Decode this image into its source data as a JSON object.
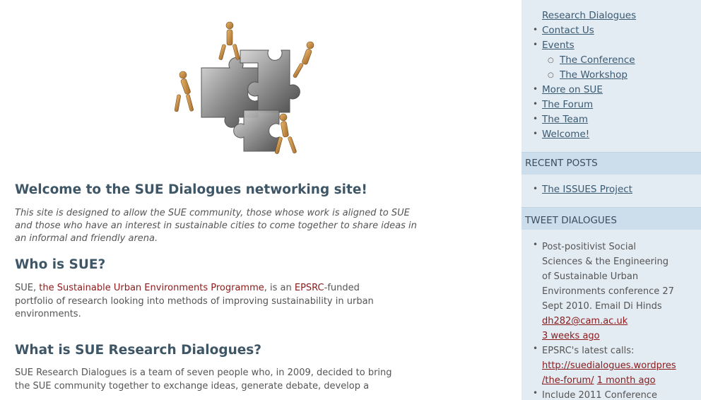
{
  "main": {
    "heading": "Welcome to the SUE Dialogues networking site!",
    "intro_line1": "This site is designed to allow the SUE community, those whose work is aligned to SUE",
    "intro_line2": "and those who have an interest in sustainable cities to come together to share ideas in",
    "intro_line3": "an informal and friendly arena.",
    "who_heading": "Who is SUE?",
    "who_prefix": "SUE, ",
    "who_link": "the Sustainable Urban Environments Programme",
    "who_mid": ",  is an ",
    "epsrc_link": "EPSRC",
    "who_rest1": "-funded",
    "who_line2": "portfolio of research looking into methods of improving sustainability in urban",
    "who_line3": "environments.",
    "what_heading": "What is SUE Research Dialogues?",
    "what_line1": "SUE Research Dialogues is a team of seven people who, in 2009, decided to bring",
    "what_line2": "the SUE community together to exchange ideas, generate debate, develop a"
  },
  "sidebar": {
    "pages": {
      "top_partial": "Research Dialogues",
      "contact": "Contact Us",
      "events": "Events",
      "conference": "The Conference",
      "workshop": "The Workshop",
      "more": "More on SUE",
      "forum": "The Forum",
      "team": "The Team",
      "welcome": "Welcome!"
    },
    "recent_posts": {
      "heading": "RECENT POSTS",
      "item1": "The ISSUES Project"
    },
    "tweets": {
      "heading": "TWEET DIALOGUES",
      "t1_line1": "Post-positivist Social",
      "t1_line2": "Sciences & the Engineering",
      "t1_line3": "of Sustainable Urban",
      "t1_line4": "Environments conference 27",
      "t1_line5": "Sept 2010. Email Di Hinds",
      "t1_line6": "dh282@cam.ac.uk",
      "t1_ago": "3 weeks ago",
      "t2_line1": "EPSRC's latest calls:",
      "t2_link1": "http://suedialogues.wordpres",
      "t2_link2": "/the-forum/",
      "t2_ago": "1 month ago",
      "t3_line1": "Include 2011 Conference"
    }
  },
  "colors": {
    "heading": "#3e5666",
    "link_red": "#8b1a1a",
    "sidebar_bg": "#e3ebf3",
    "section_head_bg": "#ccdeeb",
    "sidebar_link": "#3a5a72"
  }
}
